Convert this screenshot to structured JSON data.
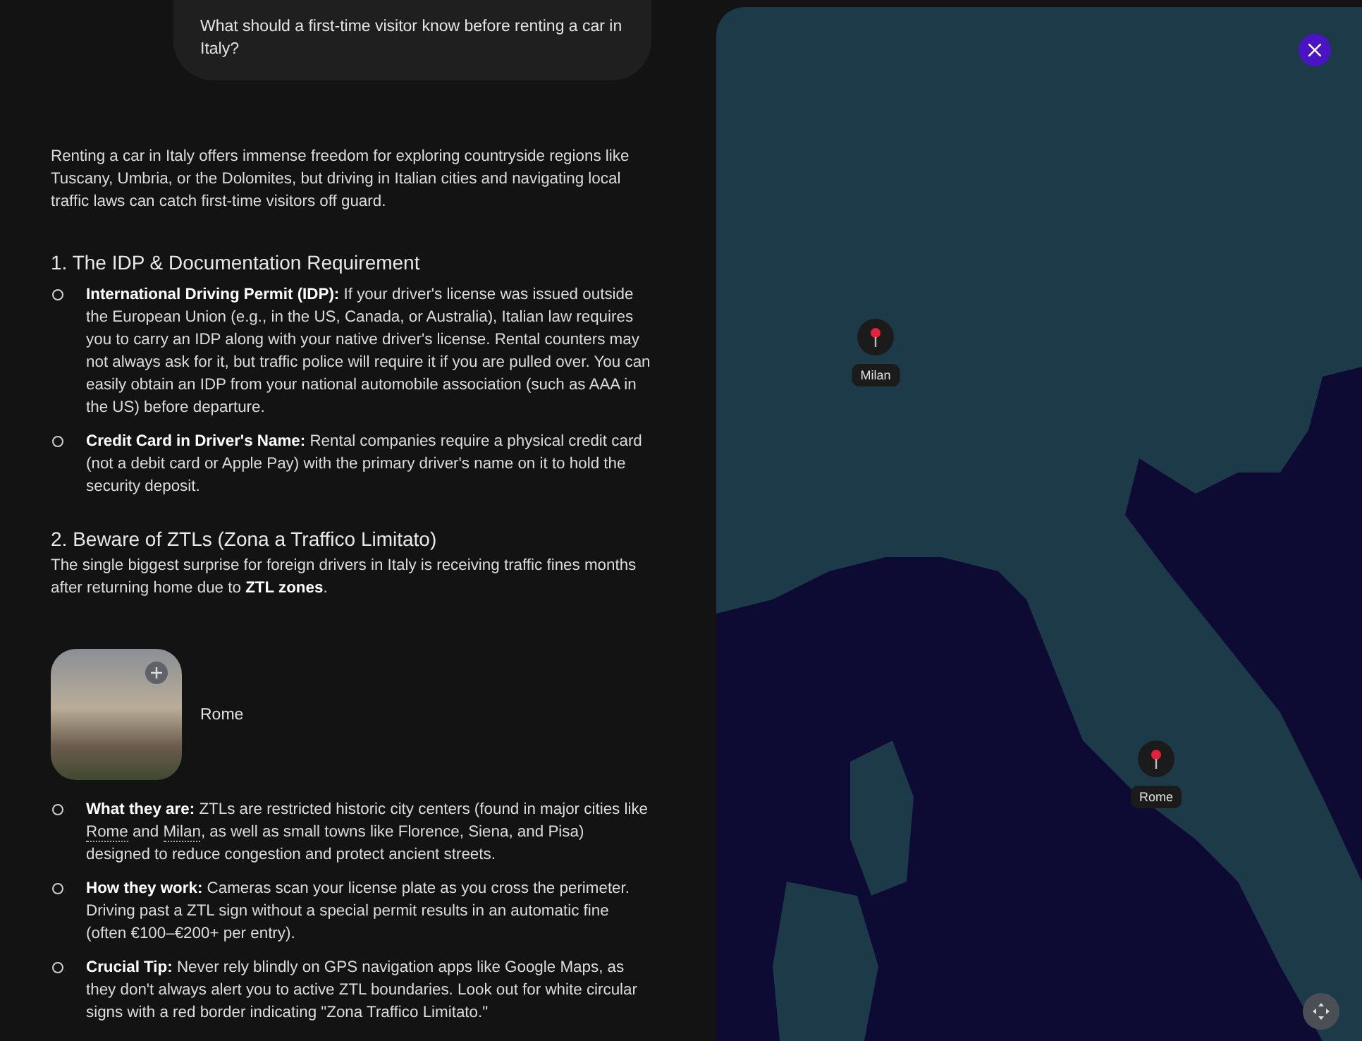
{
  "question": "What should a first-time visitor know before renting a car in Italy?",
  "blocks": [
    {
      "kind": "paragraph",
      "text": "Renting a car in Italy offers immense freedom for exploring countryside regions like Tuscany, Umbria, or the Dolomites, but driving in Italian cities and navigating local traffic laws can catch first-time visitors off guard."
    },
    {
      "kind": "heading",
      "text": "1. The IDP & Documentation Requirement"
    },
    {
      "kind": "bullets",
      "items": [
        {
          "lead": "International Driving Permit (IDP):",
          "parts": [
            {
              "kind": "text",
              "text": " If your driver's license was issued outside the European Union (e.g., in the US, Canada, or Australia), Italian law requires you to carry an IDP along with your native driver's license. Rental counters may not always ask for it, but traffic police will require it if you are pulled over. You can easily obtain an IDP from your national automobile association (such as AAA in the US) before departure."
            }
          ]
        },
        {
          "lead": "Credit Card in Driver's Name:",
          "parts": [
            {
              "kind": "text",
              "text": " Rental companies require a physical credit card (not a debit card or Apple Pay) with the primary driver's name on it to hold the security deposit."
            }
          ]
        }
      ]
    },
    {
      "kind": "heading",
      "text": "2. Beware of ZTLs (Zona a Traffico Limitato)"
    },
    {
      "kind": "paragraph",
      "text": "The single biggest surprise for foreign drivers in Italy is receiving traffic fines months after returning home due to **ZTL zones**."
    },
    {
      "kind": "place",
      "caption": "Rome"
    },
    {
      "kind": "bullets",
      "items": [
        {
          "lead": "What they are:",
          "parts": [
            {
              "kind": "text",
              "text": " ZTLs are restricted historic city centers (found in major cities like "
            },
            {
              "kind": "link",
              "text": "Rome"
            },
            {
              "kind": "text",
              "text": " and "
            },
            {
              "kind": "link",
              "text": "Milan"
            },
            {
              "kind": "text",
              "text": ", as well as small towns like Florence, Siena, and Pisa) designed to reduce congestion and protect ancient streets."
            }
          ]
        },
        {
          "lead": "How they work:",
          "parts": [
            {
              "kind": "text",
              "text": " Cameras scan your license plate as you cross the perimeter. Driving past a ZTL sign without a special permit results in an automatic fine (often €100–€200+ per entry)."
            }
          ]
        },
        {
          "lead": "Crucial Tip:",
          "parts": [
            {
              "kind": "text",
              "text": " Never rely blindly on GPS navigation apps like Google Maps, as they don't always alert you to active ZTL boundaries. Look out for white circular signs with a red border indicating \"Zona Traffico Limitato.\""
            }
          ]
        }
      ]
    }
  ],
  "map": {
    "pins": [
      {
        "label": "Milan"
      },
      {
        "label": "Rome"
      }
    ]
  }
}
